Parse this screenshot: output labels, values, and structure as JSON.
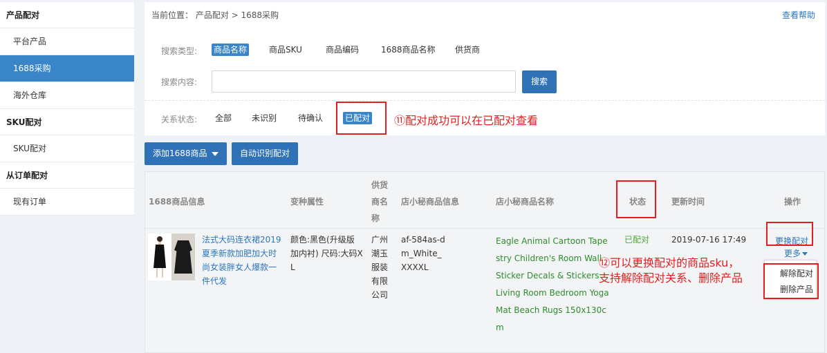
{
  "sidebar": {
    "groups": [
      {
        "title": "产品配对",
        "items": [
          {
            "label": "平台产品"
          },
          {
            "label": "1688采购"
          },
          {
            "label": "海外仓库"
          }
        ]
      },
      {
        "title": "SKU配对",
        "items": [
          {
            "label": "SKU配对"
          }
        ]
      },
      {
        "title": "从订单配对",
        "items": [
          {
            "label": "现有订单"
          }
        ]
      }
    ]
  },
  "header": {
    "breadcrumb": "当前位置：  产品配对 > 1688采购",
    "help": "查看帮助"
  },
  "search": {
    "type_label": "搜索类型:",
    "types": [
      "商品名称",
      "商品SKU",
      "商品编码",
      "1688商品名称",
      "供货商"
    ],
    "content_label": "搜索内容:",
    "input_value": "",
    "button": "搜索"
  },
  "status_filter": {
    "label": "关系状态:",
    "options": [
      "全部",
      "未识别",
      "待确认",
      "已配对"
    ]
  },
  "annotations": {
    "note11": "⑪配对成功可以在已配对查看",
    "note12_line1": "⑫可以更换配对的商品sku，",
    "note12_line2": "支持解除配对关系、删除产品"
  },
  "actions": {
    "add_1688": "添加1688商品",
    "auto_match": "自动识别配对"
  },
  "table": {
    "headers": {
      "info": "1688商品信息",
      "variant": "变种属性",
      "supplier_l1": "供货",
      "supplier_l2": "商名",
      "supplier_l3": "称",
      "xm_info": "店小秘商品信息",
      "xm_name": "店小秘商品名称",
      "status": "状态",
      "updated": "更新时间",
      "ops": "操作"
    },
    "row": {
      "title_lines": [
        "法式大码连衣裙2019",
        "夏季新款加肥加大时",
        "尚女装胖女人爆款一",
        "件代发"
      ],
      "variant_lines": [
        "颜色:黑色(升级版",
        "加内衬) 尺码:大码X",
        "L"
      ],
      "supplier_lines": [
        "广州",
        "潮玉",
        "服装",
        "有限",
        "公司"
      ],
      "sku_lines": [
        "af-584as-d",
        "m_White_",
        "XXXXL"
      ],
      "name_lines": [
        "Eagle Animal Cartoon Tape",
        "stry Children's Room Wall",
        "Sticker Decals & Stickers",
        "Living Room Bedroom Yoga",
        "Mat Beach Rugs 150x130c",
        "m"
      ],
      "status": "已配对",
      "updated": "2019-07-16 17:49",
      "op_change": "更换配对",
      "op_more": "更多",
      "op_unpair": "解除配对",
      "op_delete": "删除产品"
    }
  },
  "colors": {
    "accent": "#2f72b7",
    "sidebar_active": "#3a84c8",
    "annotation_red": "#e02020",
    "green": "#2e8b2e"
  }
}
